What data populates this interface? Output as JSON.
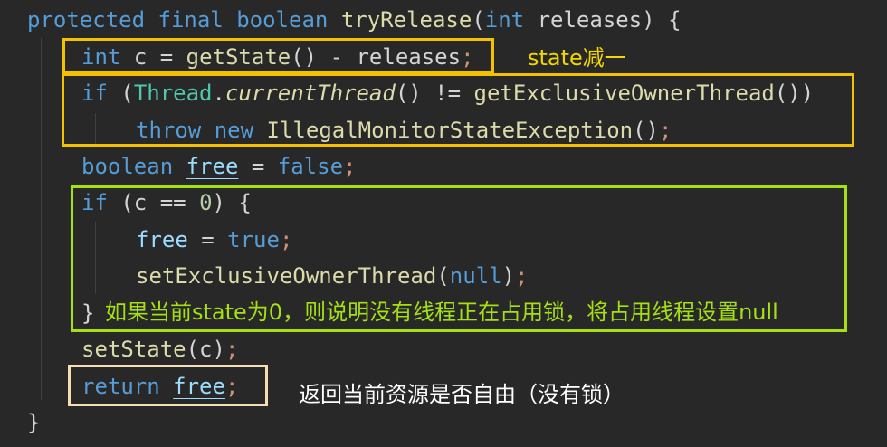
{
  "code": {
    "line1": {
      "kw1": "protected",
      "kw2": "final",
      "kw3": "boolean",
      "method": "tryRelease",
      "open": "(",
      "kw4": "int",
      "param": "releases",
      "close": ") {"
    },
    "line2": {
      "kw": "int",
      "lhs": "c =",
      "call": "getState",
      "rest": "() - releases",
      "semi": ";"
    },
    "line3": {
      "kw": "if",
      "open": "(",
      "cls": "Thread",
      "dot": ".",
      "call": "currentThread",
      "mid": "() !=",
      "call2": "getExclusiveOwnerThread",
      "close": "())"
    },
    "line4": {
      "kw1": "throw",
      "kw2": "new",
      "ctor": "IllegalMonitorStateException",
      "paren": "()",
      "semi": ";"
    },
    "line5": {
      "kw": "boolean",
      "var": "free",
      "eq": "=",
      "val": "false",
      "semi": ";"
    },
    "line6": {
      "kw": "if",
      "open": "(c ==",
      "num": "0",
      "close": ") {"
    },
    "line7": {
      "var": "free",
      "eq": "=",
      "val": "true",
      "semi": ";"
    },
    "line8": {
      "call": "setExclusiveOwnerThread",
      "open": "(",
      "arg": "null",
      "close": ")",
      "semi": ";"
    },
    "line9": {
      "brace": "}"
    },
    "line10": {
      "call": "setState",
      "args": "(c)",
      "semi": ";"
    },
    "line11": {
      "kw": "return",
      "var": "free",
      "semi": ";"
    },
    "line12": {
      "brace": "}"
    }
  },
  "annotations": {
    "state_decrement": "state减一",
    "zero_release": "如果当前state为0，则说明没有线程正在占用锁，将占用线程设置null",
    "return_free": "返回当前资源是否自由（没有锁）"
  },
  "colors": {
    "background": "#282828",
    "box_yellow": "#f2c200",
    "box_green": "#a4e012",
    "box_cream": "#f5deb3",
    "anno_yellow": "#f2d600",
    "anno_green": "#a4e012",
    "anno_white": "#ffffff"
  }
}
